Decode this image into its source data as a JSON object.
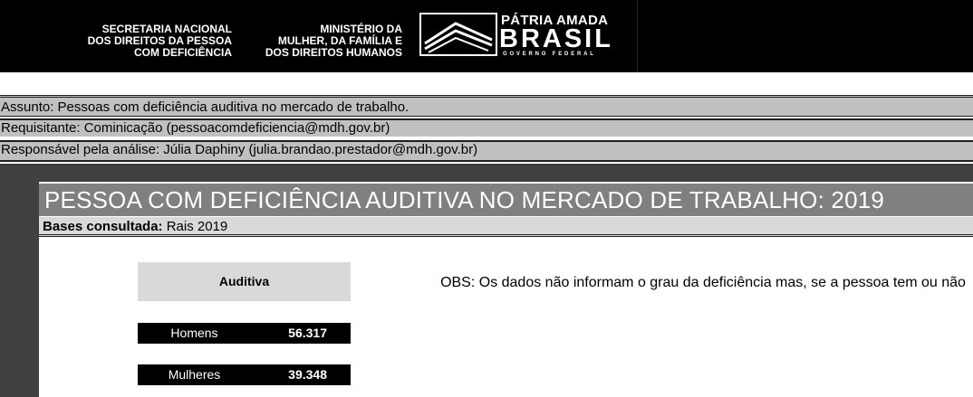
{
  "header": {
    "org1_lines": [
      "SECRETARIA NACIONAL",
      "DOS DIREITOS DA PESSOA",
      "COM DEFICIÊNCIA"
    ],
    "org2_lines": [
      "MINISTÉRIO DA",
      "MULHER, DA FAMÍLIA E",
      "DOS DIREITOS HUMANOS"
    ],
    "brand_top": "PÁTRIA AMADA",
    "brand_main": "BRASIL",
    "brand_sub": "GOVERNO FEDERAL"
  },
  "info": {
    "assunto": "Assunto: Pessoas com deficiência auditiva no mercado de trabalho.",
    "requisitante": "Requisitante: Cominicação (pessoacomdeficiencia@mdh.gov.br)",
    "responsavel": "Responsável pela análise: Júlia Daphiny (julia.brandao.prestador@mdh.gov.br)"
  },
  "report": {
    "title": "PESSOA COM DEFICIÊNCIA AUDITIVA  NO MERCADO DE TRABALHO: 2019",
    "bases_label": "Bases consultada:",
    "bases_value": " Rais 2019",
    "table_header": "Auditiva",
    "rows": [
      {
        "label": "Homens",
        "value": "56.317"
      },
      {
        "label": "Mulheres",
        "value": "39.348"
      }
    ],
    "obs": "OBS: Os dados não informam  o grau da deficiência mas, se a pessoa tem ou não"
  },
  "colors": {
    "banner": "#000000",
    "info_row": "#c0c0c0",
    "dark_area": "#404040",
    "title_bar": "#808080",
    "header_cell": "#d9d9d9"
  }
}
